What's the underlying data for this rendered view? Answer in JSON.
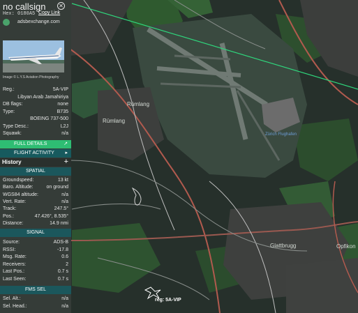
{
  "header": {
    "callsign": "no callsign",
    "hex_label": "Hex:",
    "hex": "0180A5",
    "copy_link": "Copy Link",
    "source": "adsbexchange.com"
  },
  "photo": {
    "caption": "Image © L.Y.S Aviation Photography"
  },
  "info": [
    {
      "key": "Reg.:",
      "value": "5A-VIP"
    },
    {
      "key": "",
      "value": "Libyan Arab Jamahiriya"
    },
    {
      "key": "DB flags:",
      "value": "none"
    },
    {
      "key": "Type:",
      "value": "B735"
    },
    {
      "key": "",
      "value": "BOEING 737-500"
    },
    {
      "key": "Type Desc.:",
      "value": "L2J"
    },
    {
      "key": "Squawk:",
      "value": "n/a"
    }
  ],
  "buttons": {
    "full_details": "FULL DETAILS",
    "flight_activity": "FLIGHT ACTIVITY",
    "history": "History"
  },
  "sections": {
    "spatial": "SPATIAL",
    "signal": "SIGNAL",
    "fms": "FMS SEL"
  },
  "spatial": [
    {
      "key": "Groundspeed:",
      "value": "13 kt"
    },
    {
      "key": "Baro. Altitude:",
      "value": "on ground"
    },
    {
      "key": "WGS84 altitude:",
      "value": "n/a"
    },
    {
      "key": "Vert. Rate:",
      "value": "n/a"
    },
    {
      "key": "Track:",
      "value": "247.5°"
    },
    {
      "key": "Pos.:",
      "value": "47.426°, 8.535°"
    },
    {
      "key": "Distance:",
      "value": "14.9 nmi"
    }
  ],
  "signal": [
    {
      "key": "Source:",
      "value": "ADS-B"
    },
    {
      "key": "RSSI:",
      "value": "-17.8"
    },
    {
      "key": "Msg. Rate:",
      "value": "0.6"
    },
    {
      "key": "Receivers:",
      "value": "2"
    },
    {
      "key": "Last Pos.:",
      "value": "0.7 s"
    },
    {
      "key": "Last Seen:",
      "value": "0.7 s"
    }
  ],
  "fms": [
    {
      "key": "Sel. Alt.:",
      "value": "n/a"
    },
    {
      "key": "Sel. Head.:",
      "value": "n/a"
    }
  ],
  "map": {
    "labels": {
      "rumlang1": "Rümlang",
      "rumlang2": "Rümlang",
      "glattbrugg": "Glattbrugg",
      "opfikon": "Opfikon",
      "zurich_flughafen": "Zürich Flughafen",
      "aircraft": "reg: 5A-VIP"
    }
  },
  "colors": {
    "sidebar_bg": "#353c38",
    "green_button": "#2ebd73",
    "teal_button": "#175a5e",
    "section_header": "#1b575c",
    "track_line": "#2fd67c"
  }
}
